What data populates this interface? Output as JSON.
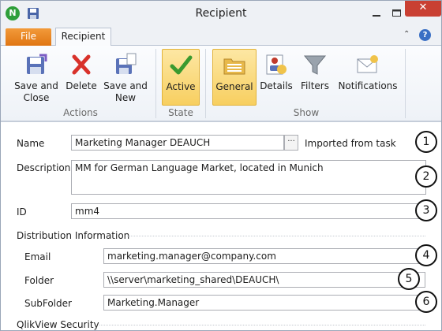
{
  "window": {
    "title": "Recipient",
    "app_logo_letter": "N"
  },
  "tabs": {
    "file": "File",
    "recipient": "Recipient"
  },
  "ribbon": {
    "groups": [
      {
        "label": "Actions",
        "buttons": [
          {
            "label_line1": "Save and",
            "label_line2": "Close",
            "icon": "save-close-icon"
          },
          {
            "label_line1": "Delete",
            "label_line2": "",
            "icon": "delete-icon"
          },
          {
            "label_line1": "Save and",
            "label_line2": "New",
            "icon": "save-new-icon"
          }
        ]
      },
      {
        "label": "State",
        "buttons": [
          {
            "label_line1": "Active",
            "label_line2": "",
            "icon": "checkmark-icon",
            "active": true
          }
        ]
      },
      {
        "label": "Show",
        "buttons": [
          {
            "label_line1": "General",
            "label_line2": "",
            "icon": "folder-icon",
            "active": true
          },
          {
            "label_line1": "Details",
            "label_line2": "",
            "icon": "details-icon"
          },
          {
            "label_line1": "Filters",
            "label_line2": "",
            "icon": "filter-icon"
          },
          {
            "label_line1": "Notifications",
            "label_line2": "",
            "icon": "envelope-icon"
          }
        ]
      }
    ]
  },
  "form": {
    "name": {
      "label": "Name",
      "value": "Marketing Manager DEAUCH",
      "ellipsis": "···",
      "note": "Imported from task"
    },
    "description": {
      "label": "Description",
      "value": "MM for German Language Market, located in Munich"
    },
    "id": {
      "label": "ID",
      "value": "mm4"
    },
    "distribution": {
      "heading": "Distribution Information",
      "email": {
        "label": "Email",
        "value": "marketing.manager@company.com"
      },
      "folder": {
        "label": "Folder",
        "value": "\\\\server\\marketing_shared\\DEAUCH\\"
      },
      "subfolder": {
        "label": "SubFolder",
        "value": "Marketing.Manager"
      }
    },
    "security": {
      "heading": "QlikView Security"
    }
  },
  "callouts": [
    "1",
    "2",
    "3",
    "4",
    "5",
    "6"
  ],
  "colors": {
    "accent_file_tab": "#e8841f",
    "active_button": "#f7cf60",
    "close_button": "#c94033",
    "brand_green": "#2e9f3a"
  }
}
